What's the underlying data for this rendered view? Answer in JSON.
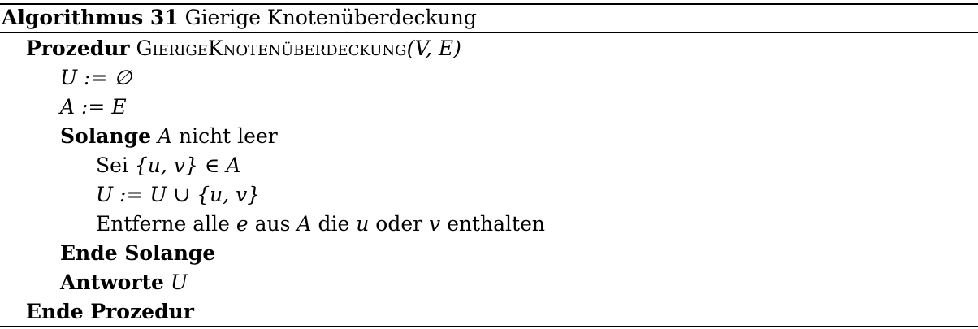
{
  "caption": {
    "label": "Algorithmus 31",
    "title": "Gierige Knotenüberdeckung"
  },
  "lines": [
    {
      "kw": "Prozedur",
      "name": "GierigeKnotenüberdeckung",
      "args": "(V, E)"
    },
    {
      "math": "U := ∅"
    },
    {
      "math": "A := E"
    },
    {
      "kw": "Solange",
      "var": "A",
      "rest": "nicht leer"
    },
    {
      "text": "Sei",
      "math": "{u, v} ∈ A"
    },
    {
      "math": "U := U ∪ {u, v}"
    },
    {
      "t1": "Entferne alle",
      "v1": "e",
      "t2": "aus",
      "v2": "A",
      "t3": "die",
      "v3": "u",
      "t4": "oder",
      "v4": "v",
      "t5": "enthalten"
    },
    {
      "kw": "Ende Solange"
    },
    {
      "kw": "Antworte",
      "var": "U"
    },
    {
      "kw": "Ende Prozedur"
    }
  ]
}
